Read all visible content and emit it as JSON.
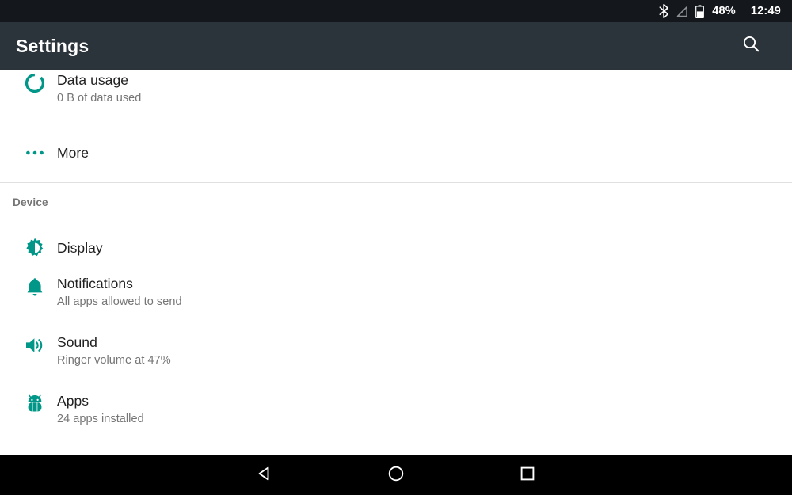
{
  "status_bar": {
    "icons": [
      "bluetooth-icon",
      "signal-off-icon",
      "battery-icon"
    ],
    "battery_percent": "48%",
    "clock": "12:49"
  },
  "action_bar": {
    "title": "Settings",
    "search_icon": "search-icon"
  },
  "colors": {
    "accent": "#009688",
    "action_bar_bg": "#2b333b",
    "status_bar_bg": "#14181c",
    "nav_bar_bg": "#000000",
    "title_text": "#212121",
    "summary_text": "#757575",
    "divider": "#e0e0e0"
  },
  "list": {
    "wireless_rows": [
      {
        "icon": "data-usage-icon",
        "title": "Data usage",
        "summary": "0 B of data used"
      },
      {
        "icon": "more-dots-icon",
        "title": "More",
        "summary": ""
      }
    ],
    "device_section": {
      "header": "Device",
      "rows": [
        {
          "icon": "brightness-icon",
          "title": "Display",
          "summary": ""
        },
        {
          "icon": "bell-icon",
          "title": "Notifications",
          "summary": "All apps allowed to send"
        },
        {
          "icon": "volume-icon",
          "title": "Sound",
          "summary": "Ringer volume at 47%"
        },
        {
          "icon": "android-icon",
          "title": "Apps",
          "summary": "24 apps installed"
        }
      ]
    }
  },
  "nav_bar": {
    "back": "back-triangle-icon",
    "home": "home-circle-icon",
    "recents": "recents-square-icon"
  }
}
